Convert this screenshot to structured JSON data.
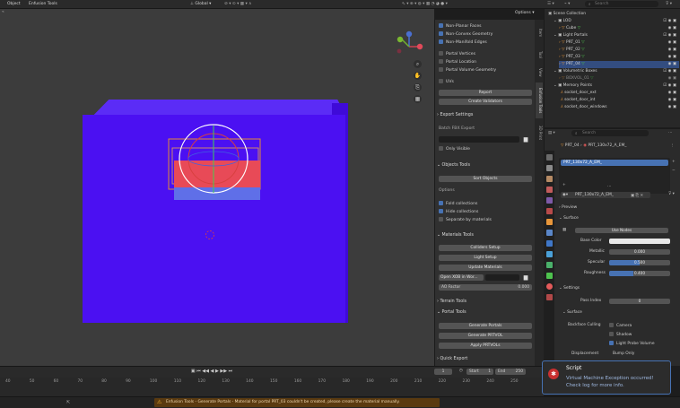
{
  "topbar": {
    "object_menu": "Object",
    "addon_menu": "Enfusion Tools",
    "transform": "Global",
    "options": "Options"
  },
  "outliner_header": {
    "search_placeholder": "Search"
  },
  "overlays": {
    "items": [
      {
        "label": "Non-Planar Faces",
        "checked": true
      },
      {
        "label": "Non-Convex Geometry",
        "checked": true
      },
      {
        "label": "Non-Manifold Edges",
        "checked": true
      },
      {
        "label": "Portal Vertices",
        "checked": false
      },
      {
        "label": "Portal Location",
        "checked": false
      },
      {
        "label": "Portal Volume Geometry",
        "checked": false
      },
      {
        "label": "UVs",
        "checked": false
      }
    ],
    "report_button": "Report",
    "validators_button": "Create Validators"
  },
  "export_settings": {
    "title": "Export Settings",
    "batch_label": "Batch FBX Export",
    "only_visible": "Only Visible"
  },
  "objects_tools": {
    "title": "Objects Tools",
    "sort_button": "Sort Objects",
    "options_label": "Options",
    "options": [
      {
        "label": "Fold collections",
        "checked": true
      },
      {
        "label": "Hide collections",
        "checked": true
      },
      {
        "label": "Separate by materials",
        "checked": false
      }
    ]
  },
  "materials_tools": {
    "title": "Materials Tools",
    "colliders_button": "Colliders Setup",
    "light_button": "Light Setup",
    "update_button": "Update Materials",
    "open_xob": "Open XOB in Wor...",
    "ao_label": "AO Factor",
    "ao_value": "0.000"
  },
  "terrain_tools": {
    "title": "Terrain Tools"
  },
  "portal_tools": {
    "title": "Portal Tools",
    "generate_button": "Generate Portals",
    "prtvol_button": "Generate PRTVOL",
    "apply_button": "Apply PRTVOLs"
  },
  "quick_export": {
    "title": "Quick Export"
  },
  "ntabs": [
    "Item",
    "Tool",
    "View",
    "Enfusion Tools",
    "3D Print"
  ],
  "outliner": [
    {
      "label": "Scene Collection",
      "indent": 0
    },
    {
      "label": "LOD",
      "indent": 1
    },
    {
      "label": "Cube",
      "indent": 2
    },
    {
      "label": "Light Portals",
      "indent": 1
    },
    {
      "label": "PRT_01",
      "indent": 2
    },
    {
      "label": "PRT_02",
      "indent": 2
    },
    {
      "label": "PRT_03",
      "indent": 2
    },
    {
      "label": "PRT_04",
      "indent": 2,
      "selected": true
    },
    {
      "label": "Volumetric Boxes",
      "indent": 1
    },
    {
      "label": "BOXVOL_01",
      "indent": 2
    },
    {
      "label": "Memory Points",
      "indent": 1
    },
    {
      "label": "socket_door_ext",
      "indent": 2
    },
    {
      "label": "socket_door_int",
      "indent": 2
    },
    {
      "label": "socket_door_windows",
      "indent": 2
    }
  ],
  "properties": {
    "search_placeholder": "Search",
    "breadcrumb_obj": "PRT_04",
    "breadcrumb_mat": "PRT_130x72_A_EM_",
    "slot": "PRT_130x72_A_EM_",
    "material_field": "PRT_130x72_A_EM_",
    "preview": "Preview",
    "surface": "Surface",
    "use_nodes": "Use Nodes",
    "base_color_label": "Base Color",
    "metallic_label": "Metallic",
    "metallic_value": "0.000",
    "specular_label": "Specular",
    "specular_value": "0.500",
    "specular_fill": 0.5,
    "roughness_label": "Roughness",
    "roughness_value": "0.400",
    "roughness_fill": 0.4,
    "settings": "Settings",
    "pass_index_label": "Pass Index",
    "pass_index_value": "0",
    "surface2": "Surface",
    "backface_label": "Backface Culling",
    "camera": "Camera",
    "shadow": "Shadow",
    "light_probe": "Light Probe Volume",
    "light_probe_checked": true,
    "displacement_label": "Displacement",
    "displacement_value": "Bump Only"
  },
  "timeline": {
    "ruler": [
      "40",
      "50",
      "60",
      "70",
      "80",
      "90",
      "100",
      "110",
      "120",
      "130",
      "140",
      "150",
      "160",
      "170",
      "180",
      "190",
      "200",
      "210",
      "220",
      "230",
      "240",
      "250"
    ],
    "current_frame": "1",
    "start_label": "Start",
    "start_value": "1",
    "end_label": "End",
    "end_value": "250"
  },
  "status": {
    "message": "Enfusion Tools - Generate Portals - Material for portal PRT_03 couldn't be created, please create the material manually."
  },
  "toast": {
    "title": "Script",
    "line1": "Virtual Machine Exception occurred!",
    "line2": "Check log for more info."
  },
  "colors": {
    "accent": "#4772b3",
    "cube": "#4b10f2",
    "warning": "#e6a020",
    "error": "#c93030"
  }
}
